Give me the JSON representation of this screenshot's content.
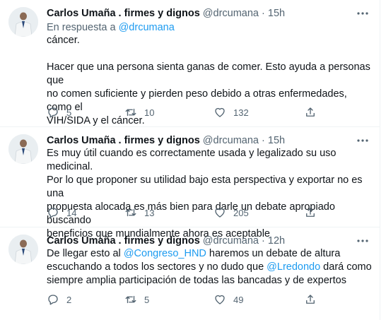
{
  "tweets": [
    {
      "author_name": "Carlos Umaña . firmes y dignos",
      "handle": "@drcumana",
      "time": "15h",
      "reply_prefix": "En respuesta a",
      "reply_to": "@drcumana",
      "lines": [
        "cáncer.",
        "",
        "Hacer que una persona sienta ganas de comer. Esto ayuda a personas que",
        "no comen suficiente y pierden peso debido a otras enfermedades, como el",
        "VIH/SIDA y el cáncer."
      ],
      "replies": "5",
      "retweets": "10",
      "likes": "132"
    },
    {
      "author_name": "Carlos Umaña . firmes y dignos",
      "handle": "@drcumana",
      "time": "15h",
      "lines": [
        "Es muy útil cuando es correctamente usada y legalizado su uso medicinal.",
        "Por lo que proponer su utilidad bajo esta perspectiva y exportar no es una",
        "propuesta alocada es más bien para darle un debate apropiado buscando",
        "beneficios que mundialmente ahora es aceptable"
      ],
      "replies": "14",
      "retweets": "13",
      "likes": "205"
    },
    {
      "author_name": "Carlos Umaña . firmes y dignos",
      "handle": "@drcumana",
      "time": "12h",
      "line1_pre": "De llegar esto al ",
      "line1_mention": "@Congreso_HND",
      "line1_post": " haremos un debate de altura",
      "line2_pre": "escuchando a todos los sectores y no dudo que ",
      "line2_mention": "@Lredondo",
      "line2_post": " dará como",
      "line3": "siempre amplia participación de todas las bancadas y de expertos",
      "replies": "2",
      "retweets": "5",
      "likes": "49"
    }
  ],
  "separator_dot": "·",
  "colors": {
    "accent": "#1d9bf0",
    "secondary_text": "#536471",
    "divider": "#eff3f4"
  },
  "icons": [
    "reply-icon",
    "retweet-icon",
    "like-icon",
    "share-icon",
    "more-icon"
  ]
}
